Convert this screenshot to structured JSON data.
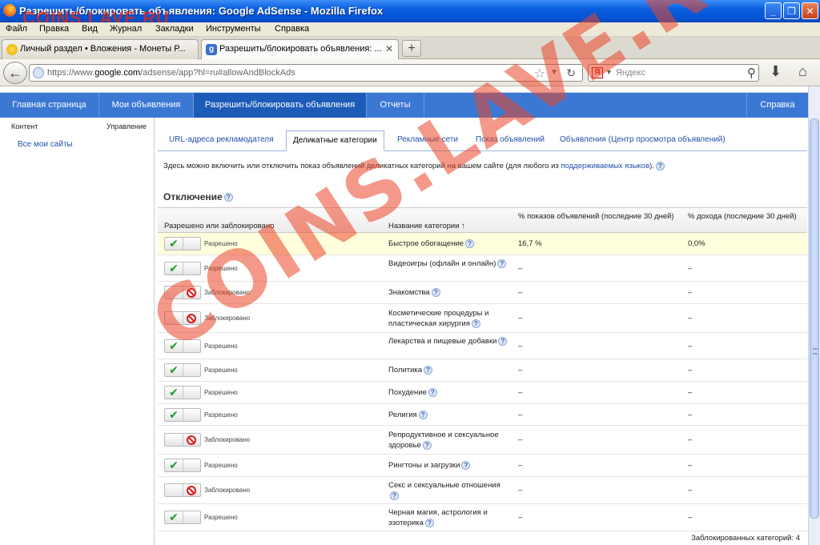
{
  "window": {
    "title": "Разрешить/блокировать объявления: Google AdSense - Mozilla Firefox",
    "watermark_top": "COINS.LAVE.RU",
    "buttons": [
      "_",
      "❐",
      "✕"
    ]
  },
  "menu": [
    "Файл",
    "Правка",
    "Вид",
    "Журнал",
    "Закладки",
    "Инструменты",
    "Справка"
  ],
  "tabs": [
    {
      "label": "Личный раздел • Вложения - Монеты Р...",
      "close": "✕"
    },
    {
      "label": "Разрешить/блокировать объявления: ...",
      "close": "✕"
    }
  ],
  "newtab": "+",
  "address": {
    "prefix": "https://www.",
    "host": "google.com",
    "path": "/adsense/app?hl=ru#allowAndBlockAds"
  },
  "search": {
    "engine": "Я",
    "placeholder": "Яндекс"
  },
  "topnav": [
    "Главная страница",
    "Мои объявления",
    "Разрешить/блокировать объявления",
    "Отчеты",
    "Справка"
  ],
  "sidebar": {
    "header_left": "Контент",
    "header_right": "Управление",
    "link": "Все мои сайты"
  },
  "subtabs": [
    "URL-адреса рекламодателя",
    "Деликатные категории",
    "Рекламные сети",
    "Показ объявлений",
    "Объявления (Центр просмотра объявлений)"
  ],
  "intro": {
    "text": "Здесь можно включить или отключить показ объявлений деликатных категорий на вашем сайте (для любого из ",
    "link": "поддерживаемых языков",
    "tail": ")."
  },
  "section_title": "Отключение",
  "table": {
    "headers": {
      "status": "Разрешено или заблокировано",
      "category": "Название категории",
      "sort": "↑",
      "impressions": "% показов объявлений (последние 30 дней)",
      "revenue": "% дохода (последние 30 дней)"
    },
    "rows": [
      {
        "status": "Разрешено",
        "allowed": true,
        "category": "Быстрое обогащение",
        "impressions": "16,7 %",
        "revenue": "0,0%"
      },
      {
        "status": "Разрешено",
        "allowed": true,
        "category": "Видеоигры (офлайн и онлайн)",
        "impressions": "–",
        "revenue": "–"
      },
      {
        "status": "Заблокировано",
        "allowed": false,
        "category": "Знакомства",
        "impressions": "–",
        "revenue": "–"
      },
      {
        "status": "Заблокировано",
        "allowed": false,
        "category": "Косметические процедуры и пластическая хирургия",
        "impressions": "–",
        "revenue": "–"
      },
      {
        "status": "Разрешено",
        "allowed": true,
        "category": "Лекарства и пищевые добавки",
        "impressions": "–",
        "revenue": "–"
      },
      {
        "status": "Разрешено",
        "allowed": true,
        "category": "Политика",
        "impressions": "–",
        "revenue": "–"
      },
      {
        "status": "Разрешено",
        "allowed": true,
        "category": "Похудение",
        "impressions": "–",
        "revenue": "–"
      },
      {
        "status": "Разрешено",
        "allowed": true,
        "category": "Религия",
        "impressions": "–",
        "revenue": "–"
      },
      {
        "status": "Заблокировано",
        "allowed": false,
        "category": "Репродуктивное и сексуальное здоровье",
        "impressions": "–",
        "revenue": "–"
      },
      {
        "status": "Разрешено",
        "allowed": true,
        "category": "Рингтоны и загрузки",
        "impressions": "–",
        "revenue": "–"
      },
      {
        "status": "Заблокировано",
        "allowed": false,
        "category": "Секс и сексуальные отношения",
        "impressions": "–",
        "revenue": "–"
      },
      {
        "status": "Разрешено",
        "allowed": true,
        "category": "Черная магия, астрология и эзотерика",
        "impressions": "–",
        "revenue": "–"
      }
    ]
  },
  "blocked_count": "Заблокированных категорий: 4",
  "watermark": "COINS.LAVE.RU",
  "colors": {
    "nav": "#3b78d4",
    "nav_active": "#1d5bb9",
    "link": "#2050a8",
    "allow": "#1f9d2b",
    "block": "#d81b1b",
    "highlight": "#ffffdd"
  }
}
